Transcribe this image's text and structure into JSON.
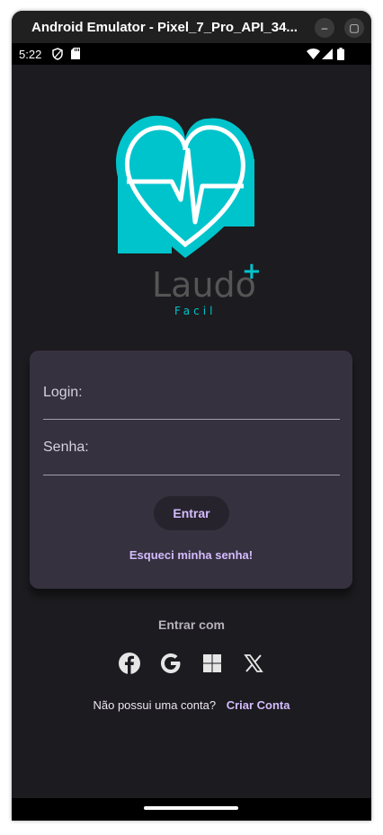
{
  "window": {
    "title": "Android Emulator - Pixel_7_Pro_API_34...",
    "minimize_label": "–",
    "maximize_label": "▢"
  },
  "status_bar": {
    "time": "5:22"
  },
  "logo": {
    "word": "Laudo",
    "plus": "+",
    "subtitle": "Facil"
  },
  "login_card": {
    "login_label": "Login:",
    "password_label": "Senha:",
    "submit_label": "Entrar",
    "forgot_label": "Esqueci minha senha!"
  },
  "social": {
    "heading": "Entrar com",
    "providers": [
      "facebook-icon",
      "google-icon",
      "windows-icon",
      "x-icon"
    ]
  },
  "signup": {
    "question": "Não possui uma conta?",
    "link_label": "Criar Conta"
  },
  "colors": {
    "background": "#1c1b1f",
    "card": "#36313f",
    "accent": "#d3bcfd",
    "brand_teal": "#00c4cc"
  }
}
